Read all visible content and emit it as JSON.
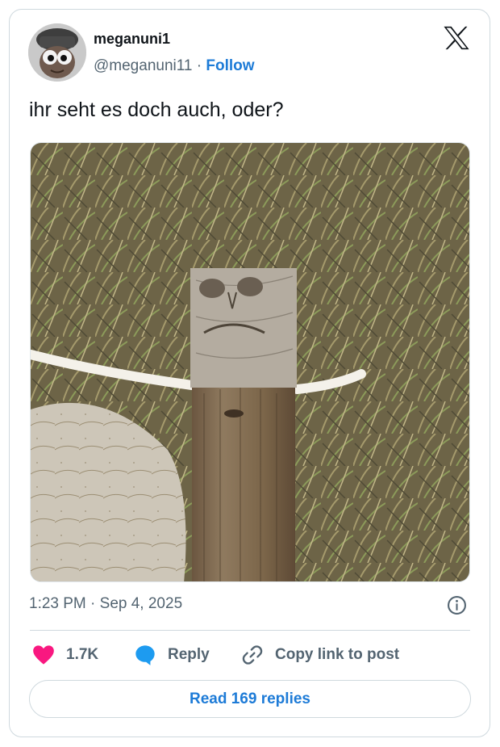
{
  "author": {
    "display_name": "meganuni1",
    "handle": "@meganuni11",
    "separator": "·",
    "follow_label": "Follow"
  },
  "tweet": {
    "text": "ihr seht es doch auch, oder?"
  },
  "meta": {
    "time": "1:23 PM",
    "separator": "·",
    "date": "Sep 4, 2025"
  },
  "actions": {
    "like_count": "1.7K",
    "reply_label": "Reply",
    "copy_label": "Copy link to post"
  },
  "footer": {
    "read_replies_label": "Read 169 replies"
  },
  "icons": {
    "platform": "x-logo-icon",
    "info": "info-icon",
    "like": "heart-icon",
    "reply": "speech-bubble-icon",
    "copy": "link-icon"
  },
  "colors": {
    "accent": "#1d7bd7",
    "heart": "#f91880",
    "secondary_text": "#536471",
    "border": "#cfd9de"
  }
}
